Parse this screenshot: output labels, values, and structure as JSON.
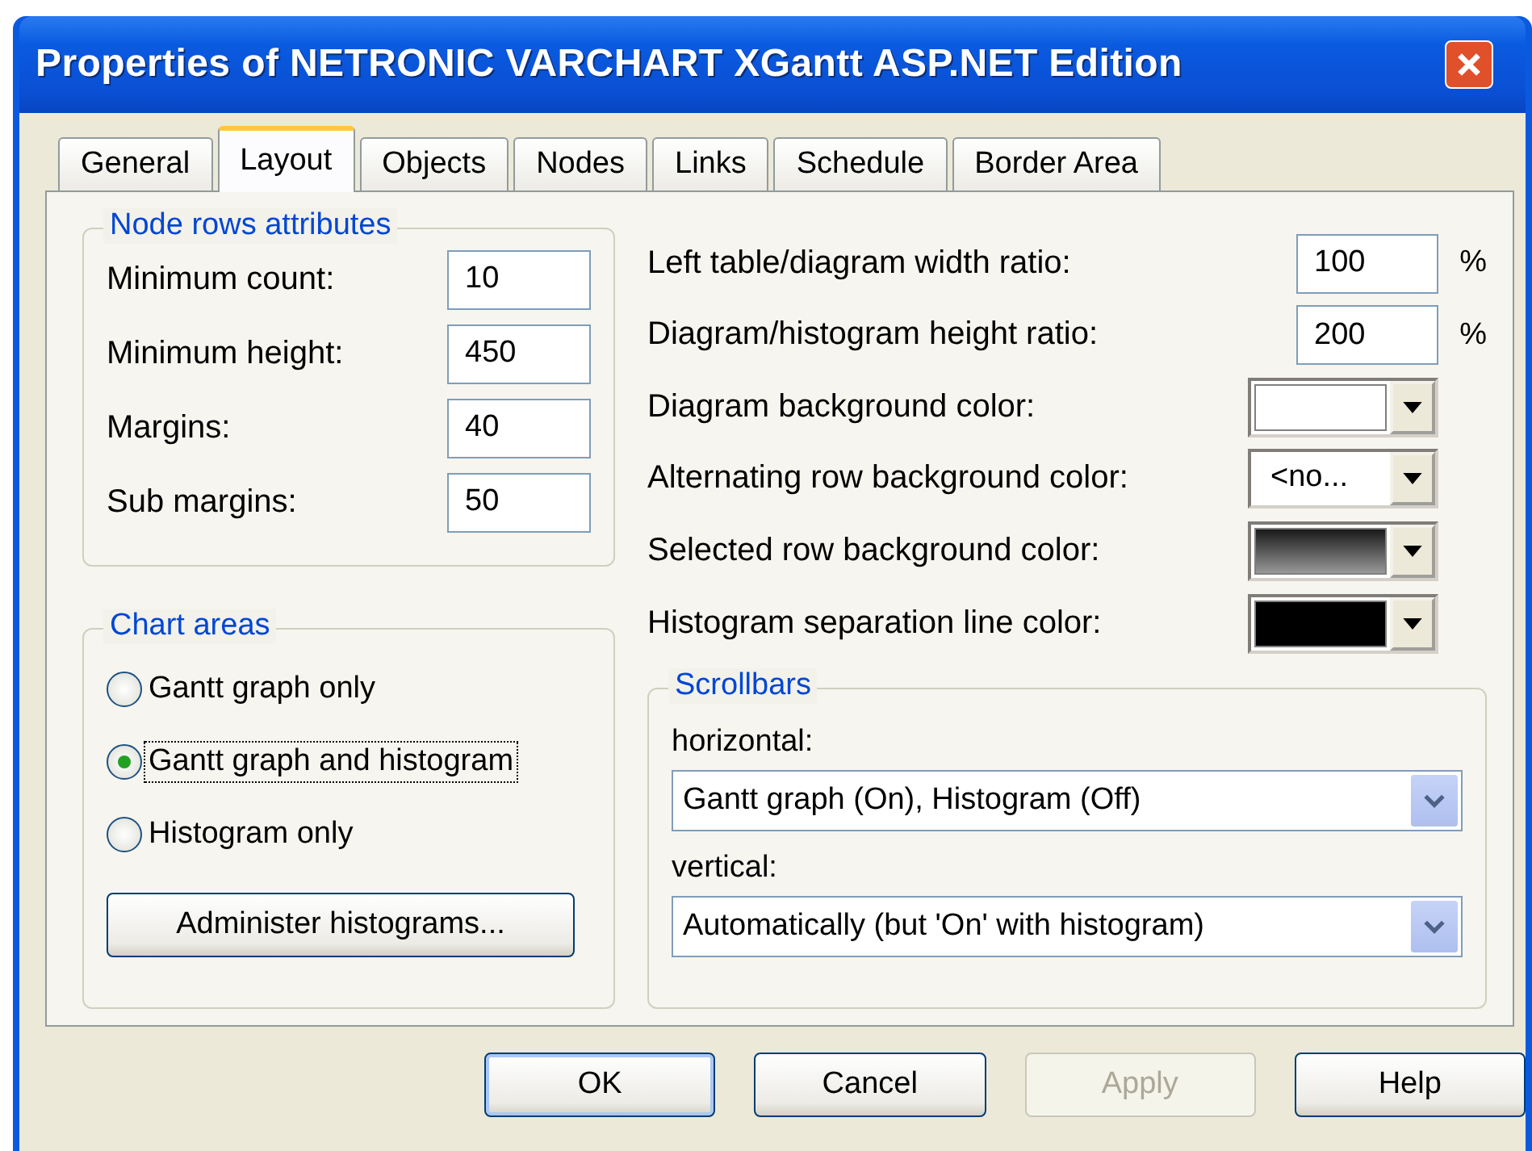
{
  "window": {
    "title": "Properties of NETRONIC VARCHART XGantt ASP.NET Edition"
  },
  "tabs": [
    {
      "label": "General",
      "selected": false
    },
    {
      "label": "Layout",
      "selected": true
    },
    {
      "label": "Objects",
      "selected": false
    },
    {
      "label": "Nodes",
      "selected": false
    },
    {
      "label": "Links",
      "selected": false
    },
    {
      "label": "Schedule",
      "selected": false
    },
    {
      "label": "Border Area",
      "selected": false
    }
  ],
  "node_rows": {
    "title": "Node rows attributes",
    "fields": [
      {
        "label": "Minimum count:",
        "value": "10"
      },
      {
        "label": "Minimum height:",
        "value": "450"
      },
      {
        "label": "Margins:",
        "value": "40"
      },
      {
        "label": "Sub margins:",
        "value": "50"
      }
    ]
  },
  "chart_areas": {
    "title": "Chart areas",
    "options": [
      {
        "label": "Gantt graph only",
        "selected": false
      },
      {
        "label": "Gantt graph and histogram",
        "selected": true
      },
      {
        "label": "Histogram only",
        "selected": false
      }
    ],
    "button": "Administer histograms..."
  },
  "settings": [
    {
      "kind": "number",
      "label": "Left table/diagram width ratio:",
      "value": "100",
      "unit": "%"
    },
    {
      "kind": "number",
      "label": "Diagram/histogram height ratio:",
      "value": "200",
      "unit": "%"
    },
    {
      "kind": "color",
      "label": "Diagram background color:",
      "color": "#ffffff"
    },
    {
      "kind": "text",
      "label": "Alternating row background color:",
      "value": "<no..."
    },
    {
      "kind": "dithered",
      "label": "Selected row background color:",
      "color": "#1a1a1a"
    },
    {
      "kind": "color",
      "label": "Histogram separation line color:",
      "color": "#000000"
    }
  ],
  "scrollbars": {
    "title": "Scrollbars",
    "selects": [
      {
        "label": "horizontal:",
        "value": "Gantt graph (On), Histogram (Off)"
      },
      {
        "label": "vertical:",
        "value": "Automatically (but 'On' with histogram)"
      }
    ]
  },
  "buttons": [
    {
      "label": "OK",
      "disabled": false,
      "default": true
    },
    {
      "label": "Cancel",
      "disabled": false,
      "default": false
    },
    {
      "label": "Apply",
      "disabled": true,
      "default": false
    },
    {
      "label": "Help",
      "disabled": false,
      "default": false
    }
  ]
}
